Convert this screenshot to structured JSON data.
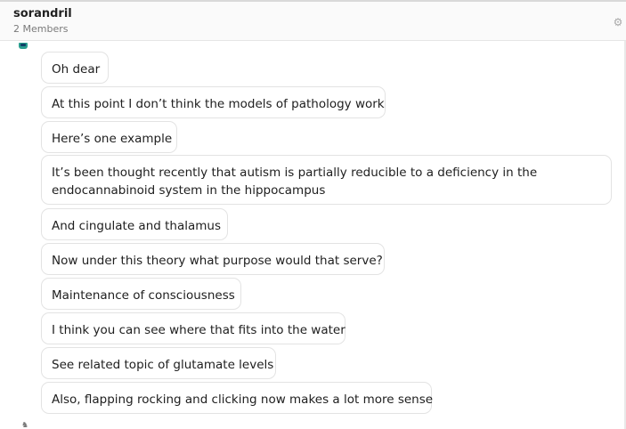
{
  "header": {
    "title": "sorandril",
    "subtitle": "2 Members",
    "settings_icon": "gear-icon"
  },
  "messages": [
    "Oh dear",
    "At this point I don’t think the models of pathology work",
    "Here’s one example",
    "It’s been thought recently that autism is partially reducible to a deficiency in the endocannabinoid system in the hippocampus",
    "And cingulate and thalamus",
    "Now under this theory what purpose would that serve?",
    "Maintenance of consciousness",
    "I think you can see where that fits into the water",
    "See related topic of glutamate levels",
    "Also, flapping rocking and clicking now makes a lot more sense"
  ]
}
